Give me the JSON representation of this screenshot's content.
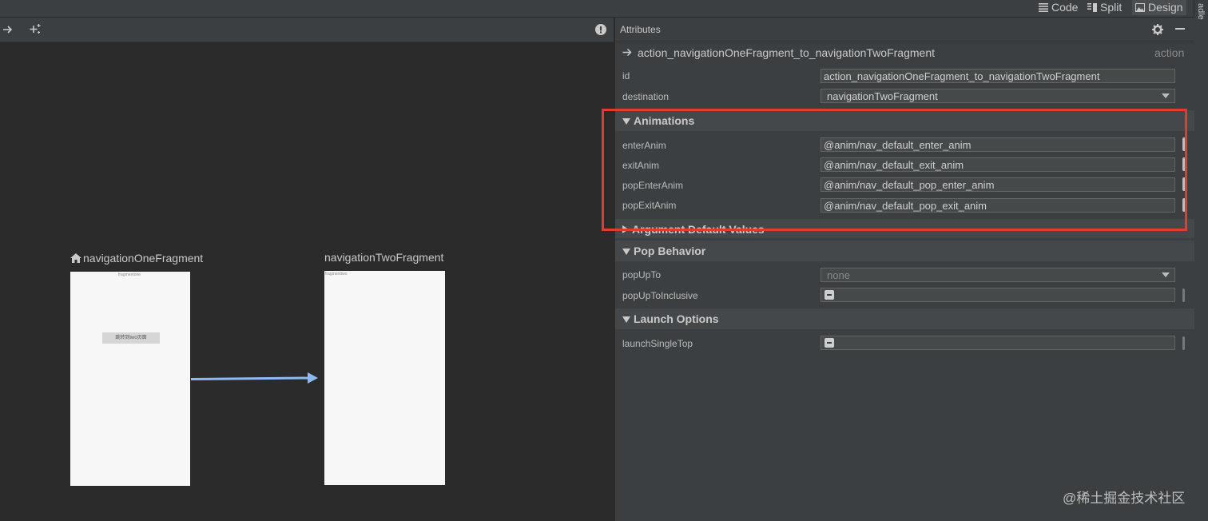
{
  "mode_bar": {
    "code_label": "Code",
    "split_label": "Split",
    "design_label": "Design",
    "active": "Design"
  },
  "side_tab_label": "adle",
  "canvas": {
    "destinations": [
      {
        "name": "navigationOneFragment",
        "is_start": true,
        "screen_label": "fragmentone",
        "screen_button": "跳转到two页面"
      },
      {
        "name": "navigationTwoFragment",
        "is_start": false,
        "screen_label": "fragmenttwo"
      }
    ],
    "arrow_color": "#8fb9f2"
  },
  "attributes": {
    "title": "Attributes",
    "element_name": "action_navigationOneFragment_to_navigationTwoFragment",
    "element_type": "action",
    "id_label": "id",
    "id_value": "action_navigationOneFragment_to_navigationTwoFragment",
    "destination_label": "destination",
    "destination_value": "navigationTwoFragment",
    "sections": {
      "animations": "Animations",
      "argument_defaults": "Argument Default Values",
      "pop_behavior": "Pop Behavior",
      "launch_options": "Launch Options"
    },
    "animations": [
      {
        "label": "enterAnim",
        "value": "@anim/nav_default_enter_anim"
      },
      {
        "label": "exitAnim",
        "value": "@anim/nav_default_exit_anim"
      },
      {
        "label": "popEnterAnim",
        "value": "@anim/nav_default_pop_enter_anim"
      },
      {
        "label": "popExitAnim",
        "value": "@anim/nav_default_pop_exit_anim"
      }
    ],
    "pop_up_to_label": "popUpTo",
    "pop_up_to_value": "none",
    "pop_up_to_inclusive_label": "popUpToInclusive",
    "launch_single_top_label": "launchSingleTop",
    "highlight_color": "#e03c31"
  },
  "watermark": "@稀土掘金技术社区"
}
